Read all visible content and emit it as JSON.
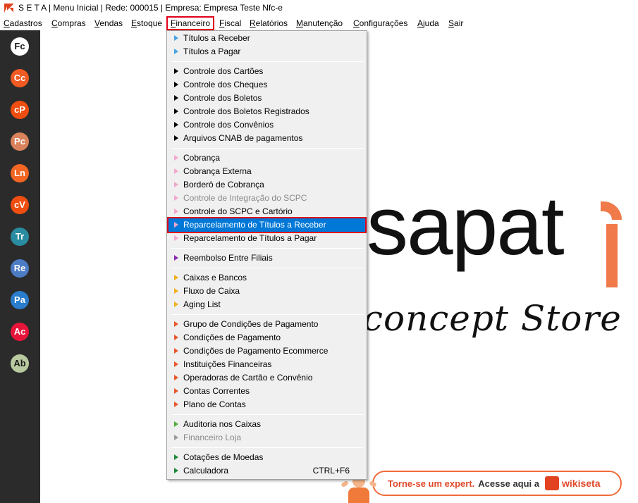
{
  "window": {
    "title": "S E T A | Menu Inicial | Rede: 000015 | Empresa: Empresa Teste Nfc-e"
  },
  "menubar": [
    {
      "pre": "",
      "ul": "C",
      "post": "adastros"
    },
    {
      "pre": "",
      "ul": "C",
      "post": "ompras"
    },
    {
      "pre": "",
      "ul": "V",
      "post": "endas"
    },
    {
      "pre": "",
      "ul": "E",
      "post": "stoque"
    },
    {
      "pre": "",
      "ul": "F",
      "post": "inanceiro"
    },
    {
      "pre": "",
      "ul": "F",
      "post": "iscal"
    },
    {
      "pre": "",
      "ul": "R",
      "post": "elatórios"
    },
    {
      "pre": "",
      "ul": "M",
      "post": "anutenção"
    },
    {
      "pre": "",
      "ul": "C",
      "post": "onfigurações"
    },
    {
      "pre": "",
      "ul": "A",
      "post": "juda"
    },
    {
      "pre": "",
      "ul": "S",
      "post": "air"
    }
  ],
  "sidebar": [
    {
      "label": "Fc",
      "bg": "#ffffff",
      "fg": "#1a1a1a"
    },
    {
      "label": "Cc",
      "bg": "#f15a22",
      "fg": "#ffffff"
    },
    {
      "label": "cP",
      "bg": "#f04e10",
      "fg": "#ffffff"
    },
    {
      "label": "Pc",
      "bg": "#d9825b",
      "fg": "#ffffff"
    },
    {
      "label": "Ln",
      "bg": "#f26522",
      "fg": "#ffffff"
    },
    {
      "label": "cV",
      "bg": "#f04e10",
      "fg": "#ffffff"
    },
    {
      "label": "Tr",
      "bg": "#2a8ca0",
      "fg": "#ffffff"
    },
    {
      "label": "Re",
      "bg": "#4c7cc4",
      "fg": "#ffffff"
    },
    {
      "label": "Pa",
      "bg": "#2a7ccc",
      "fg": "#ffffff"
    },
    {
      "label": "Ac",
      "bg": "#e8153a",
      "fg": "#ffffff"
    },
    {
      "label": "Ab",
      "bg": "#b9c9a0",
      "fg": "#1a1a1a"
    }
  ],
  "financeiro_menu": [
    {
      "label": "Títulos a Receber",
      "icon": "#4aa3df",
      "state": "normal"
    },
    {
      "label": "Títulos a Pagar",
      "icon": "#4aa3df",
      "state": "normal"
    },
    {
      "sep": true
    },
    {
      "label": "Controle dos Cartões",
      "icon": "#000000",
      "state": "normal"
    },
    {
      "label": "Controle dos Cheques",
      "icon": "#000000",
      "state": "normal"
    },
    {
      "label": "Controle dos Boletos",
      "icon": "#000000",
      "state": "normal"
    },
    {
      "label": "Controle dos Boletos Registrados",
      "icon": "#000000",
      "state": "normal"
    },
    {
      "label": "Controle dos Convênios",
      "icon": "#000000",
      "state": "normal"
    },
    {
      "label": "Arquivos CNAB de pagamentos",
      "icon": "#000000",
      "state": "normal"
    },
    {
      "sep": true
    },
    {
      "label": "Cobrança",
      "icon": "#f2a7cf",
      "state": "normal"
    },
    {
      "label": "Cobrança Externa",
      "icon": "#f2a7cf",
      "state": "normal"
    },
    {
      "label": "Borderô de Cobrança",
      "icon": "#f2a7cf",
      "state": "normal"
    },
    {
      "label": "Controle de Integração do SCPC",
      "icon": "#f2a7cf",
      "state": "disabled"
    },
    {
      "label": "Controle do SCPC e Cartório",
      "icon": "#f2a7cf",
      "state": "normal"
    },
    {
      "label": "Reparcelamento de Títulos a Receber",
      "icon": "#f2a7cf",
      "state": "selected"
    },
    {
      "label": "Reparcelamento de Títulos a Pagar",
      "icon": "#f2a7cf",
      "state": "normal"
    },
    {
      "sep": true
    },
    {
      "label": "Reembolso Entre Filiais",
      "icon": "#8a2bb0",
      "state": "normal"
    },
    {
      "sep": true
    },
    {
      "label": "Caixas e Bancos",
      "icon": "#f0b020",
      "state": "normal"
    },
    {
      "label": "Fluxo de Caixa",
      "icon": "#f0b020",
      "state": "normal"
    },
    {
      "label": "Aging List",
      "icon": "#f0b020",
      "state": "normal"
    },
    {
      "sep": true
    },
    {
      "label": "Grupo de Condições de Pagamento",
      "icon": "#e8572a",
      "state": "normal"
    },
    {
      "label": "Condições de Pagamento",
      "icon": "#e8572a",
      "state": "normal"
    },
    {
      "label": "Condições de Pagamento Ecommerce",
      "icon": "#e8572a",
      "state": "normal"
    },
    {
      "label": "Instituições Financeiras",
      "icon": "#e8572a",
      "state": "normal"
    },
    {
      "label": "Operadoras de Cartão e Convênio",
      "icon": "#e8572a",
      "state": "normal"
    },
    {
      "label": "Contas Correntes",
      "icon": "#e8572a",
      "state": "normal"
    },
    {
      "label": "Plano de Contas",
      "icon": "#e8572a",
      "state": "normal"
    },
    {
      "sep": true
    },
    {
      "label": "Auditoria nos Caixas",
      "icon": "#4caf3a",
      "state": "normal"
    },
    {
      "label": "Financeiro Loja",
      "icon": "#9a9a9a",
      "state": "disabled"
    },
    {
      "sep": true
    },
    {
      "label": "Cotações de Moedas",
      "icon": "#1e8a3a",
      "state": "normal"
    },
    {
      "label": "Calculadora",
      "icon": "#1e8a3a",
      "state": "normal",
      "shortcut": "CTRL+F6"
    }
  ],
  "brand": {
    "name": "sapat",
    "tagline": "concept Store"
  },
  "expert_banner": {
    "text1": "Torne-se um expert.",
    "text2": "Acesse aqui a",
    "logo_text": "wikiseta"
  },
  "colors": {
    "selection": "#0078d7",
    "highlight_border": "#e0001b",
    "sidebar_bg": "#2b2b2b"
  }
}
